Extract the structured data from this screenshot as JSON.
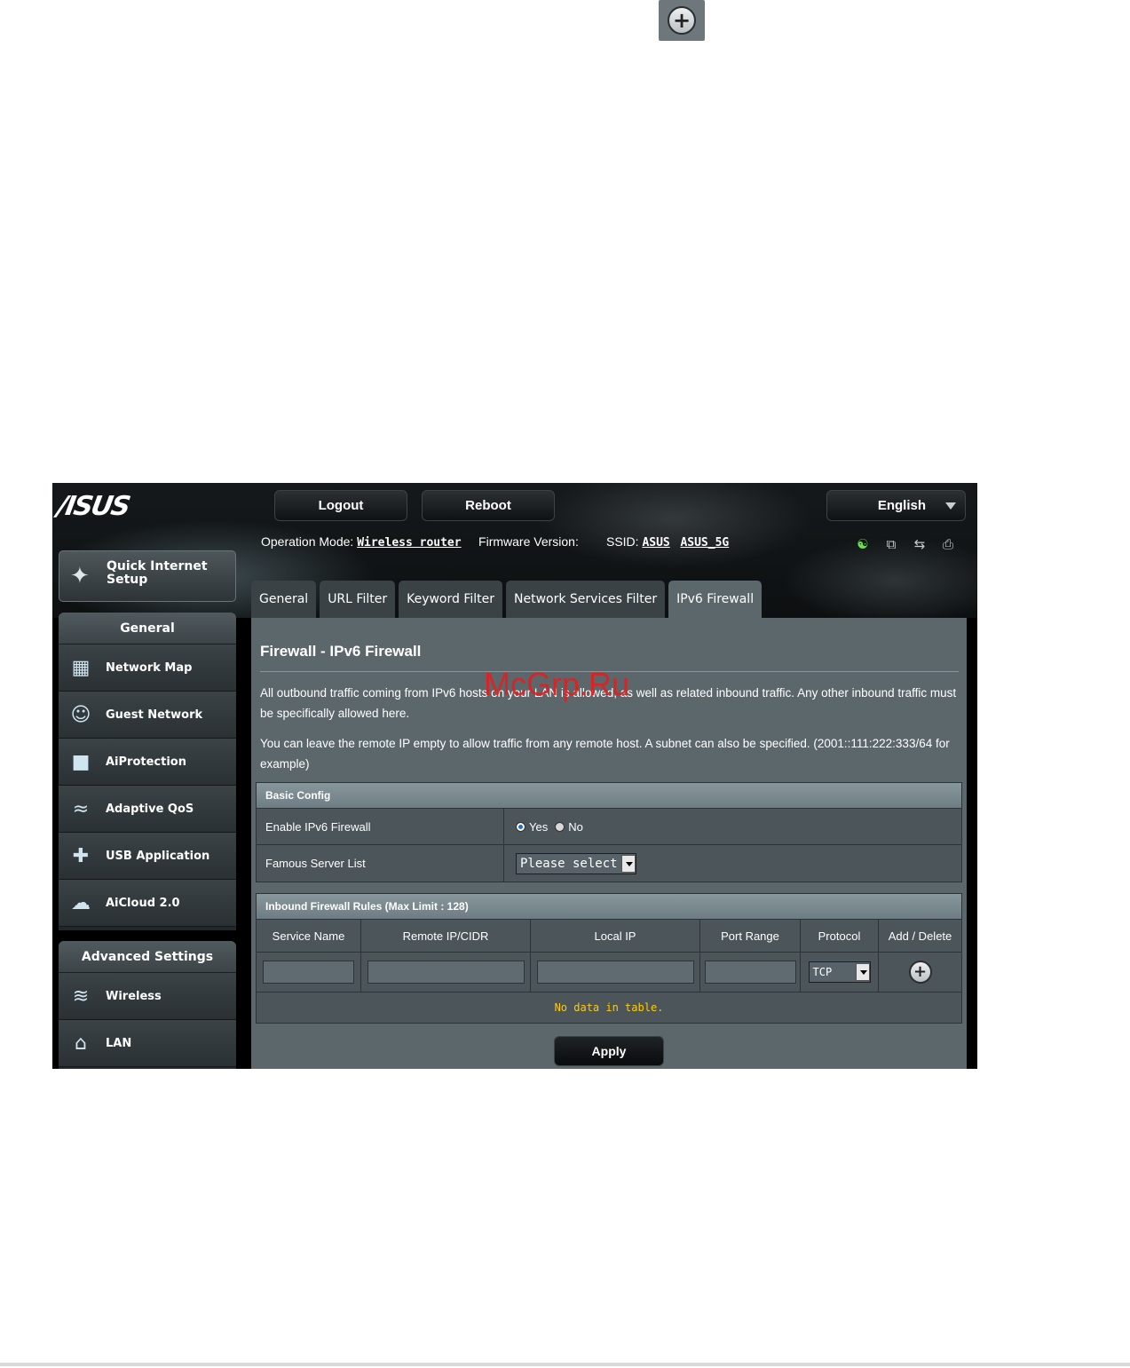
{
  "top_icon": "add-circle-icon",
  "header": {
    "logo": "/ISUS",
    "logout_label": "Logout",
    "reboot_label": "Reboot",
    "language": "English"
  },
  "status": {
    "operation_mode_label": "Operation Mode:",
    "operation_mode_value": "Wireless router",
    "firmware_label": "Firmware Version:",
    "ssid_label": "SSID:",
    "ssid_1": "ASUS",
    "ssid_2": "ASUS_5G",
    "icons": [
      "user-icon",
      "devices-icon",
      "usb-icon",
      "printer-icon"
    ]
  },
  "sidebar": {
    "quick_setup": "Quick Internet Setup",
    "general_header": "General",
    "general_items": [
      {
        "label": "Network Map",
        "icon": "network-map-icon"
      },
      {
        "label": "Guest Network",
        "icon": "guest-network-icon"
      },
      {
        "label": "AiProtection",
        "icon": "lock-icon"
      },
      {
        "label": "Adaptive QoS",
        "icon": "qos-icon"
      },
      {
        "label": "USB Application",
        "icon": "puzzle-icon"
      },
      {
        "label": "AiCloud 2.0",
        "icon": "cloud-icon"
      }
    ],
    "advanced_header": "Advanced Settings",
    "advanced_items": [
      {
        "label": "Wireless",
        "icon": "wifi-icon"
      },
      {
        "label": "LAN",
        "icon": "home-icon"
      }
    ]
  },
  "tabs": [
    {
      "label": "General",
      "active": false
    },
    {
      "label": "URL Filter",
      "active": false
    },
    {
      "label": "Keyword Filter",
      "active": false
    },
    {
      "label": "Network Services Filter",
      "active": false
    },
    {
      "label": "IPv6 Firewall",
      "active": true
    }
  ],
  "main": {
    "title": "Firewall - IPv6 Firewall",
    "watermark": "McGrp.Ru",
    "desc_1": "All outbound traffic coming from IPv6 hosts on your LAN is allowed, as well as related inbound traffic. Any other inbound traffic must be specifically allowed here.",
    "desc_2": "You can leave the remote IP empty to allow traffic from any remote host. A subnet can also be specified. (2001::111:222:333/64 for example)"
  },
  "basic_config": {
    "header": "Basic Config",
    "enable_label": "Enable IPv6 Firewall",
    "yes_label": "Yes",
    "no_label": "No",
    "selected": "Yes",
    "server_list_label": "Famous Server List",
    "server_list_value": "Please select"
  },
  "rules": {
    "header": "Inbound Firewall Rules (Max Limit : 128)",
    "columns": [
      "Service Name",
      "Remote IP/CIDR",
      "Local IP",
      "Port Range",
      "Protocol",
      "Add / Delete"
    ],
    "protocol_value": "TCP",
    "empty_text": "No data in table."
  },
  "apply_label": "Apply"
}
